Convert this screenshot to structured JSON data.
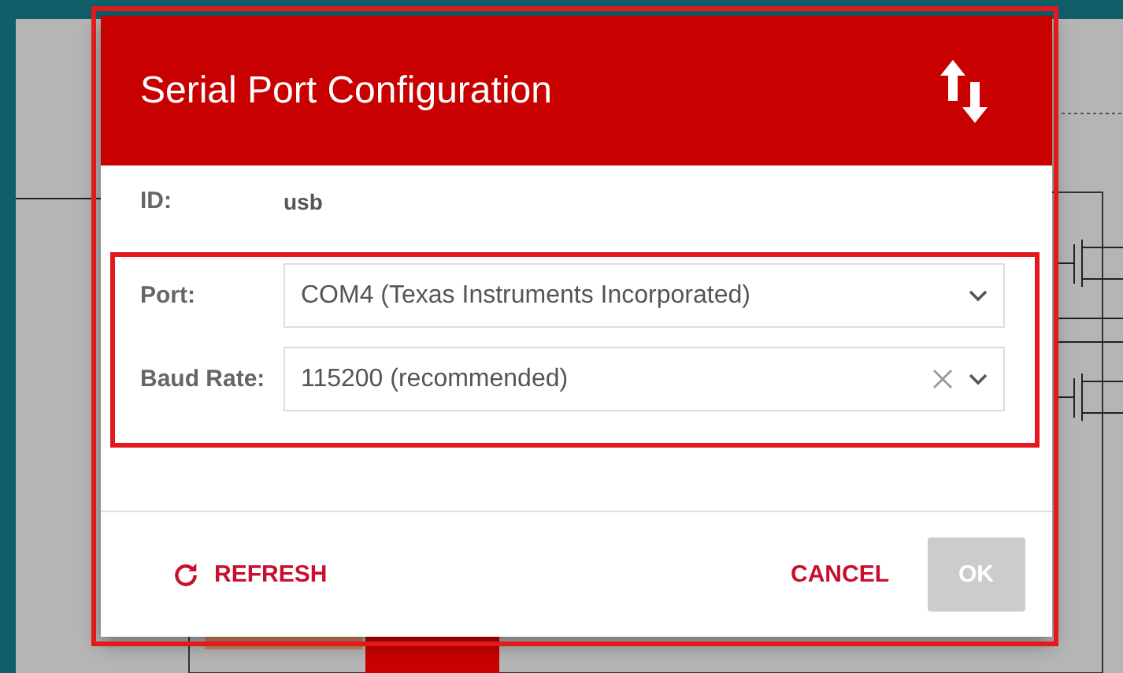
{
  "dialog": {
    "title": "Serial Port Configuration",
    "id": {
      "label": "ID:",
      "value": "usb"
    },
    "fields": [
      {
        "label": "Port:",
        "value": "COM4 (Texas Instruments Incorporated)",
        "clearable": false
      },
      {
        "label": "Baud Rate:",
        "value": "115200 (recommended)",
        "clearable": true
      }
    ],
    "actions": [
      {
        "kind": "refresh",
        "label": "REFRESH",
        "disabled": false
      },
      {
        "kind": "cancel",
        "label": "CANCEL",
        "disabled": false
      },
      {
        "kind": "ok",
        "label": "OK",
        "disabled": true
      }
    ]
  }
}
